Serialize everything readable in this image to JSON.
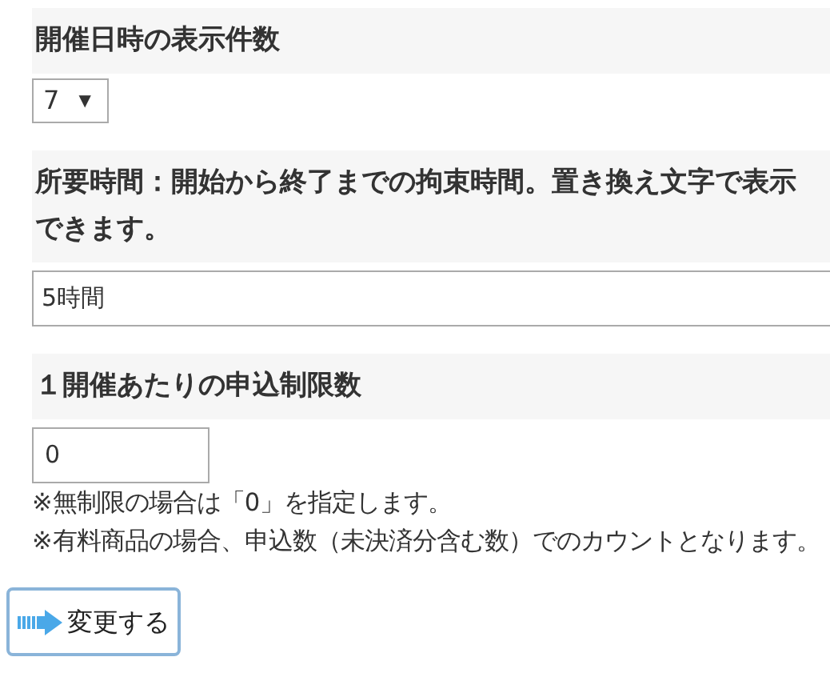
{
  "fields": [
    {
      "kind": "select",
      "label": "開催日時の表示件数",
      "value": "7",
      "arrow": "▼"
    },
    {
      "kind": "text",
      "label": "所要時間：開始から終了までの拘束時間。置き換え文字で表示できます。",
      "value": "5時間"
    },
    {
      "kind": "number",
      "label": "１開催あたりの申込制限数",
      "value": "0",
      "notes": [
        "※無制限の場合は「0」を指定します。",
        "※有料商品の場合、申込数（未決済分含む数）でのカウントとなります。"
      ]
    }
  ],
  "submit": {
    "label": "変更する"
  }
}
